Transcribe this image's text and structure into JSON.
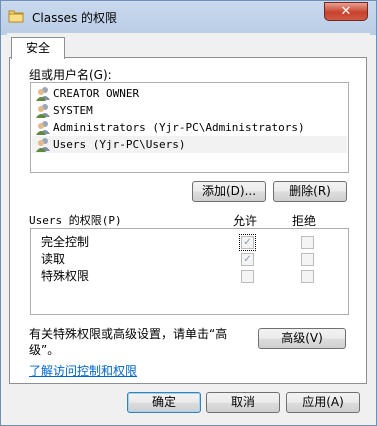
{
  "window": {
    "title": "Classes 的权限",
    "close_label": "✕"
  },
  "tab": {
    "label": "安全"
  },
  "users": {
    "label": "组或用户名(G):",
    "items": [
      {
        "name": "CREATOR OWNER"
      },
      {
        "name": "SYSTEM"
      },
      {
        "name": "Administrators (Yjr-PC\\Administrators)"
      },
      {
        "name": "Users (Yjr-PC\\Users)"
      }
    ],
    "add_label": "添加(D)...",
    "remove_label": "删除(R)"
  },
  "permissions": {
    "title": "Users 的权限(P)",
    "allow_header": "允许",
    "deny_header": "拒绝",
    "rows": [
      {
        "name": "完全控制",
        "allow": "✓",
        "deny": ""
      },
      {
        "name": "读取",
        "allow": "✓",
        "deny": ""
      },
      {
        "name": "特殊权限",
        "allow": "",
        "deny": ""
      }
    ]
  },
  "advanced": {
    "text_line1": "有关特殊权限或高级设置，请单击“高",
    "text_line2": "级”。",
    "button_label": "高级(V)"
  },
  "help_link": "了解访问控制和权限",
  "footer": {
    "ok": "确定",
    "cancel": "取消",
    "apply": "应用(A)"
  }
}
